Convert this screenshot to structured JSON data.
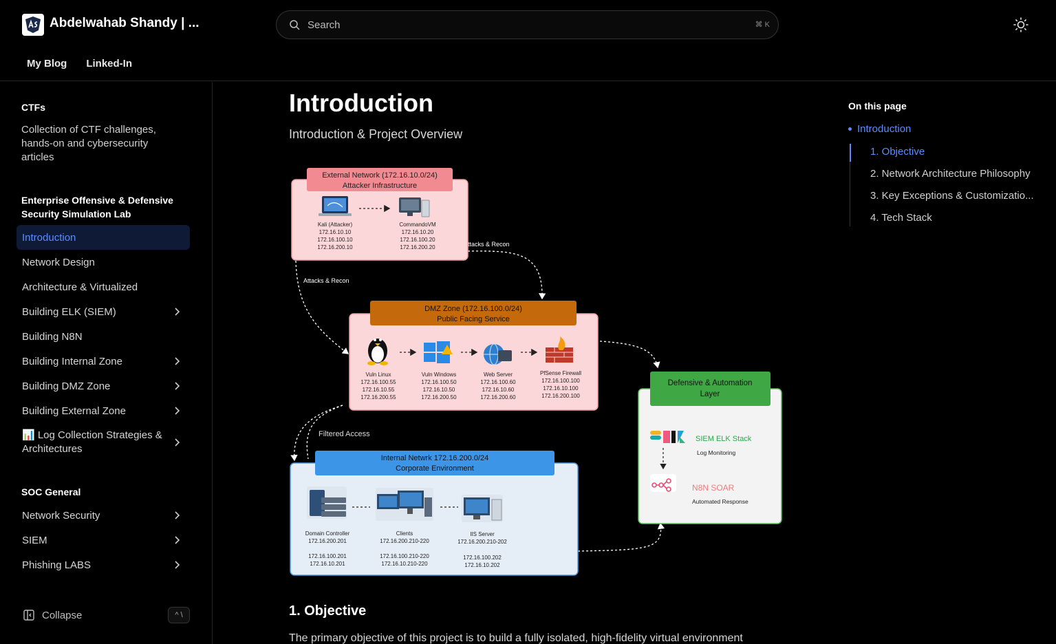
{
  "site": {
    "title": "Abdelwahab Shandy | ..."
  },
  "search": {
    "placeholder": "Search",
    "shortcut": "⌘ K"
  },
  "topnav": [
    {
      "label": "My Blog"
    },
    {
      "label": "Linked-In"
    }
  ],
  "sidebar": {
    "ctfs_title": "CTFs",
    "ctfs_desc": "Collection of CTF challenges, hands-on and cybersecurity articles",
    "lab_title": "Enterprise Offensive & Defensive Security Simulation Lab",
    "items": [
      {
        "label": "Introduction"
      },
      {
        "label": "Network Design"
      },
      {
        "label": "Architecture & Virtualized"
      },
      {
        "label": "Building ELK (SIEM)"
      },
      {
        "label": "Building N8N"
      },
      {
        "label": "Building Internal Zone"
      },
      {
        "label": "Building DMZ Zone"
      },
      {
        "label": "Building External Zone"
      },
      {
        "label": "📊 Log Collection Strategies & Architectures"
      }
    ],
    "soc_title": "SOC General",
    "soc_items": [
      {
        "label": "Network Security"
      },
      {
        "label": "SIEM"
      },
      {
        "label": "Phishing LABS"
      }
    ],
    "collapse_label": "Collapse",
    "collapse_kbd": "^ \\"
  },
  "main": {
    "title": "Introduction",
    "subtitle": "Introduction & Project Overview",
    "section1_title": "1. Objective",
    "section1_text": "The primary objective of this project is to build a fully isolated, high-fidelity virtual environment"
  },
  "diagram": {
    "external": {
      "title1": "External Network (172.16.10.0/24)",
      "title2": "Attacker Infrastructure",
      "kali_name": "Kali (Attacker)",
      "kali_ips": [
        "172.16.10.10",
        "172.16.100.10",
        "172.16.200.10"
      ],
      "cmd_name": "CommandoVM",
      "cmd_ips": [
        "172.16.10.20",
        "172.16.100.20",
        "172.16.200.20"
      ]
    },
    "attacks_label": "Attacks & Recon",
    "filtered_label": "Filtered Access",
    "dmz": {
      "title1": "DMZ Zone (172.16.100.0/24)",
      "title2": "Public Facing Service",
      "nodes": [
        {
          "name": "Vuln Linux",
          "ips": [
            "172.16.100.55",
            "172.16.10.55",
            "172.16.200.55"
          ]
        },
        {
          "name": "Vuln Windows",
          "ips": [
            "172.16.100.50",
            "172.16.10.50",
            "172.16.200.50"
          ]
        },
        {
          "name": "Web Server",
          "ips": [
            "172.16.100.60",
            "172.16.10.60",
            "172.16.200.60"
          ]
        },
        {
          "name": "PfSense Firewall",
          "ips": [
            "172.16.100.100",
            "172.16.10.100",
            "172.16.200.100"
          ]
        }
      ]
    },
    "defensive": {
      "title1": "Defensive & Automation",
      "title2": "Layer",
      "siem_name": "SIEM ELK Stack",
      "siem_desc": "Log Monitoring",
      "soar_name": "N8N SOAR",
      "soar_desc": "Automated Response"
    },
    "internal": {
      "title1": "Internal Netwrk 172.16.200.0/24",
      "title2": "Corporate Environment",
      "dc_name": "Domain Controller",
      "dc_ips": [
        "172.16.200.201",
        "172.16.100.201",
        "172.16.10.201"
      ],
      "clients_name": "Clients",
      "clients_ips": [
        "172.16.200.210-220",
        "172.16.100.210-220",
        "172.16.10.210-220"
      ],
      "iis_name": "IIS Server",
      "iis_ips": [
        "172.16.200.210-202",
        "172.16.100.202",
        "172.16.10.202"
      ]
    }
  },
  "toc": {
    "title": "On this page",
    "active": "Introduction",
    "items": [
      {
        "label": "1. Objective"
      },
      {
        "label": "2. Network Architecture Philosophy"
      },
      {
        "label": "3. Key Exceptions & Customizatio..."
      },
      {
        "label": "4. Tech Stack"
      }
    ]
  },
  "colors": {
    "accent": "#5b8cff",
    "active_bg": "#0f1a36"
  }
}
